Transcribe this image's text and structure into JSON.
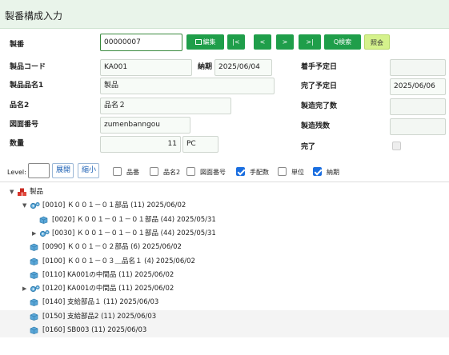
{
  "window": {
    "title": "製番構成入力"
  },
  "header": {
    "seiban_label": "製番",
    "seiban_value": "00000007",
    "buttons": {
      "edit": "編集",
      "first": "|<",
      "prev": "<",
      "next": ">",
      "last": ">|",
      "search": "Q検索",
      "confirm": "照会"
    }
  },
  "form": {
    "product_code_label": "製品コード",
    "product_code": "KA001",
    "due_label": "納期",
    "due": "2025/06/04",
    "start_label": "着手予定日",
    "start": "",
    "product_name_label": "製品品名1",
    "product_name": "製品",
    "complete_plan_label": "完了予定日",
    "complete_plan": "2025/06/06",
    "name2_label": "品名2",
    "name2": "品名２",
    "made_count_label": "製造完了数",
    "made_count": "",
    "drawing_label": "図面番号",
    "drawing": "zumenbanngou",
    "remain_label": "製造残数",
    "remain": "",
    "qty_label": "数量",
    "qty": "11",
    "unit": "PC",
    "done_label": "完了"
  },
  "options": {
    "level_label": "Level:",
    "level_value": "",
    "expand": "展開",
    "collapse": "縮小",
    "checks": [
      {
        "label": "品番",
        "checked": false
      },
      {
        "label": "品名2",
        "checked": false
      },
      {
        "label": "図面番号",
        "checked": false
      },
      {
        "label": "手配数",
        "checked": true
      },
      {
        "label": "単位",
        "checked": false
      },
      {
        "label": "納期",
        "checked": true
      }
    ]
  },
  "tree": [
    {
      "text": "製品",
      "level": 0,
      "icon": "red-boxes-icon",
      "caret": "down"
    },
    {
      "text": "[0010] Ｋ００１－０１部品 (11) 2025/06/02",
      "level": 1,
      "icon": "gear-icon",
      "caret": "down"
    },
    {
      "text": "[0020] Ｋ００１－０１－０１部品 (44) 2025/05/31",
      "level": 2,
      "icon": "box-icon",
      "caret": ""
    },
    {
      "text": "[0030] Ｋ００１－０１－０１部品 (44) 2025/05/31",
      "level": 2,
      "icon": "gear-icon",
      "caret": "right"
    },
    {
      "text": "[0090] Ｋ００１－０２部品 (6) 2025/06/02",
      "level": 1,
      "icon": "box-icon",
      "caret": ""
    },
    {
      "text": "[0100] Ｋ００１－０３＿品名１ (4) 2025/06/02",
      "level": 1,
      "icon": "box-icon",
      "caret": ""
    },
    {
      "text": "[0110] KA001の中間品 (11) 2025/06/02",
      "level": 1,
      "icon": "box-icon",
      "caret": ""
    },
    {
      "text": "[0120] KA001の中間品 (11) 2025/06/02",
      "level": 1,
      "icon": "gear-icon",
      "caret": "right"
    },
    {
      "text": "[0140] 支給部品１ (11) 2025/06/03",
      "level": 1,
      "icon": "box-icon",
      "caret": ""
    },
    {
      "text": "[0150] 支給部品2 (11) 2025/06/03",
      "level": 1,
      "icon": "box-icon",
      "caret": ""
    },
    {
      "text": "[0160] SB003 (11) 2025/06/03",
      "level": 1,
      "icon": "box-icon",
      "caret": ""
    }
  ],
  "colors": {
    "accent": "#1f9e4a",
    "titlebar": "#e9f4ea",
    "check": "#1a6ee0"
  }
}
